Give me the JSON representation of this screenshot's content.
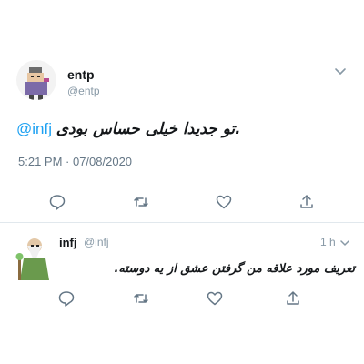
{
  "colors": {
    "accent": "#1da1f2",
    "muted": "#8899a6",
    "text": "#14171a",
    "divider": "#e1e8ed",
    "icon": "#657786"
  },
  "main_tweet": {
    "name": "entp",
    "handle": "@entp",
    "mention": "@infj",
    "text": "تو جدیدا خیلی حساس بودی.",
    "timestamp": "5:21 PM · 07/08/2020",
    "icons": [
      "reply-icon",
      "retweet-icon",
      "like-icon",
      "share-icon",
      "chevron-down-icon"
    ]
  },
  "reply_tweet": {
    "name": "infj",
    "handle": "@infj",
    "time": "1 h",
    "text": "تعریف مورد علاقه من گرفتن عشق از یه دوسته.",
    "icons": [
      "reply-icon",
      "retweet-icon",
      "like-icon",
      "share-icon",
      "chevron-down-icon"
    ]
  }
}
